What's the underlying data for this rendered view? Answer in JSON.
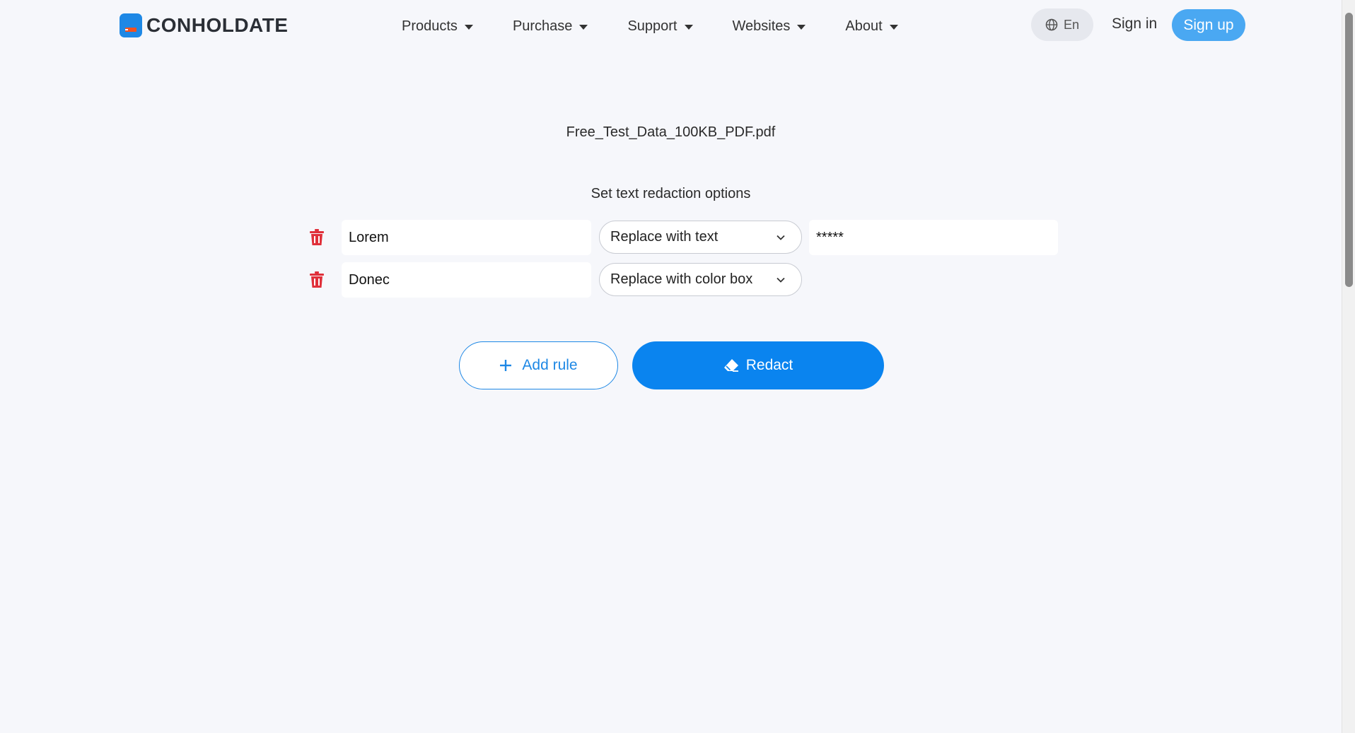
{
  "header": {
    "brand": "CONHOLDATE",
    "nav": [
      {
        "label": "Products"
      },
      {
        "label": "Purchase"
      },
      {
        "label": "Support"
      },
      {
        "label": "Websites"
      },
      {
        "label": "About"
      }
    ],
    "language": "En",
    "sign_in": "Sign in",
    "sign_up": "Sign up"
  },
  "main": {
    "filename": "Free_Test_Data_100KB_PDF.pdf",
    "options_title": "Set text redaction options",
    "rules": [
      {
        "text": "Lorem",
        "action": "Replace with text",
        "replacement": "*****"
      },
      {
        "text": "Donec",
        "action": "Replace with color box"
      }
    ],
    "add_rule_label": "Add rule",
    "redact_label": "Redact"
  },
  "colors": {
    "accent": "#0a84ef",
    "signup": "#4aa8f2",
    "trash": "#e0303a",
    "background": "#f6f7fb"
  }
}
